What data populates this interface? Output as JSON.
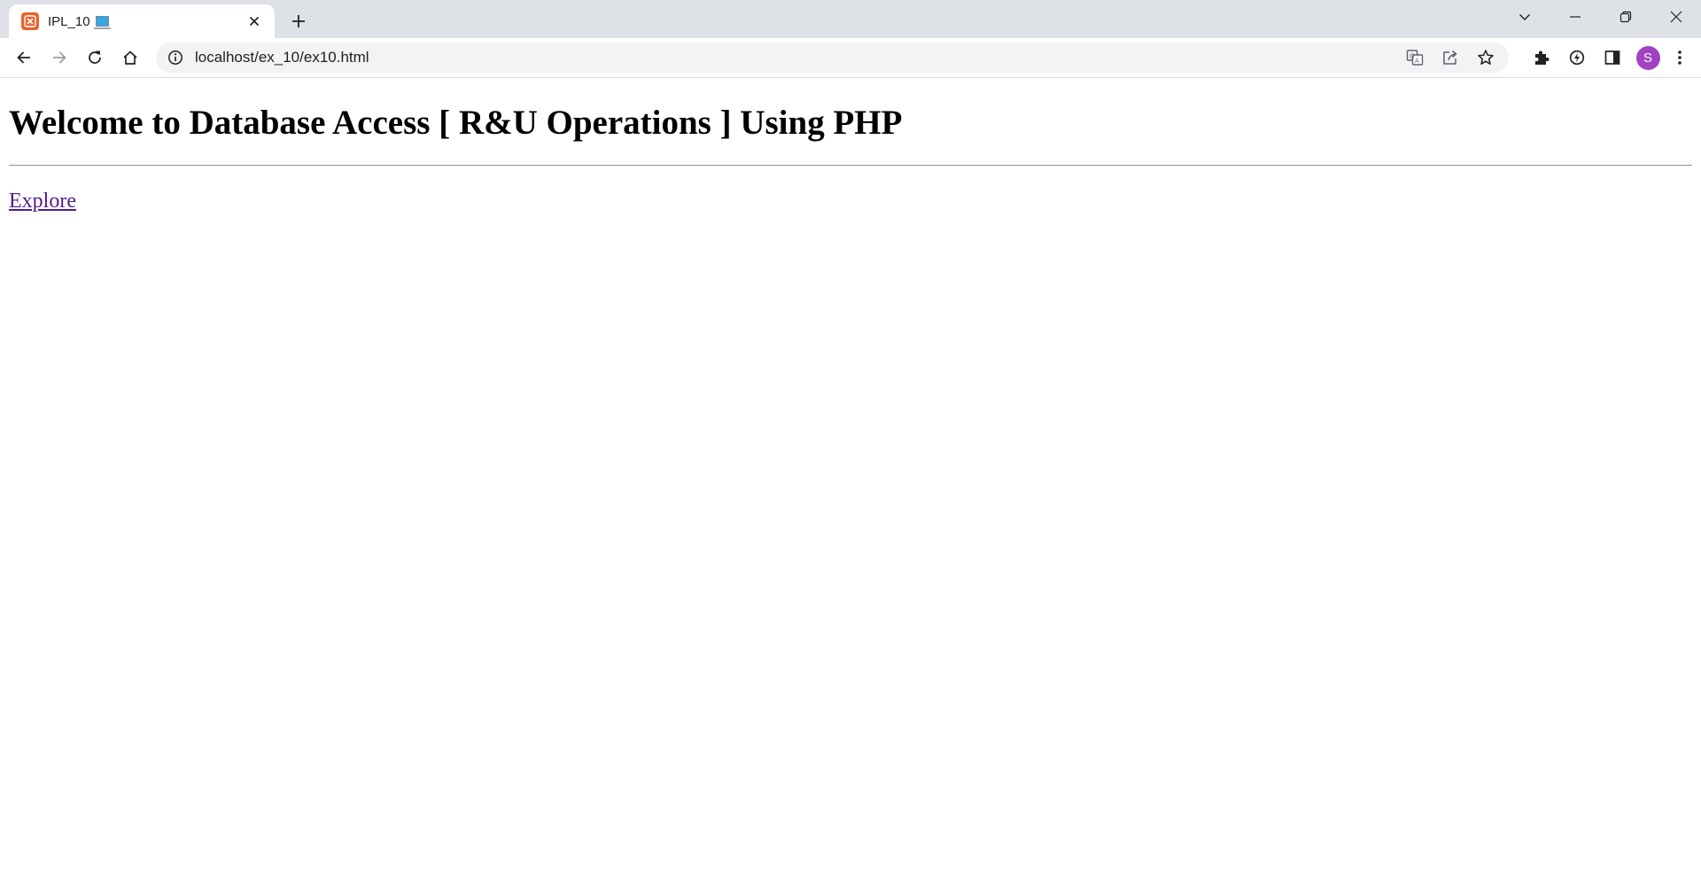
{
  "browser": {
    "tab": {
      "title": "IPL_10",
      "favicon": "xampp-icon",
      "emoji": "laptop-icon"
    },
    "address": {
      "url": "localhost/ex_10/ex10.html"
    },
    "profile": {
      "initial": "S",
      "color": "#a142c5"
    }
  },
  "page": {
    "heading": "Welcome to Database Access [ R&U Operations ] Using PHP",
    "link_label": "Explore",
    "link_color": "#551a8b"
  }
}
